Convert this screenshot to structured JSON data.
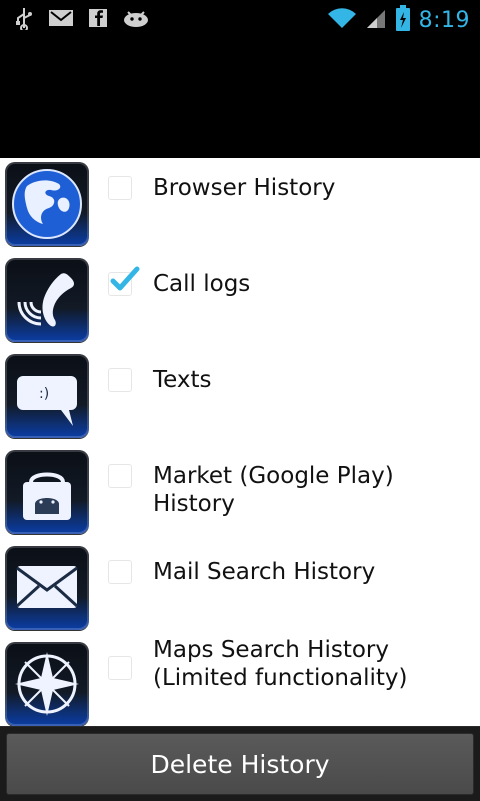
{
  "status_bar": {
    "time": "8:19",
    "left_icons": [
      "usb-icon",
      "gmail-icon",
      "facebook-icon",
      "android-icon"
    ],
    "right_icons": [
      "wifi-icon",
      "signal-icon",
      "battery-icon"
    ]
  },
  "items": [
    {
      "label": "Browser History",
      "checked": false,
      "icon": "globe-icon"
    },
    {
      "label": "Call logs",
      "checked": true,
      "icon": "phone-icon"
    },
    {
      "label": "Texts",
      "checked": false,
      "icon": "message-icon"
    },
    {
      "label": "Market (Google Play) History",
      "checked": false,
      "icon": "market-bag-icon"
    },
    {
      "label": "Mail Search History",
      "checked": false,
      "icon": "mail-icon"
    },
    {
      "label": "Maps Search History\n(Limited functionality)",
      "checked": false,
      "icon": "compass-icon"
    }
  ],
  "footer": {
    "button_label": "Delete History"
  },
  "colors": {
    "accent": "#33b5e5",
    "check": "#33b5e5",
    "tile_blue": "#0b3ea8"
  }
}
